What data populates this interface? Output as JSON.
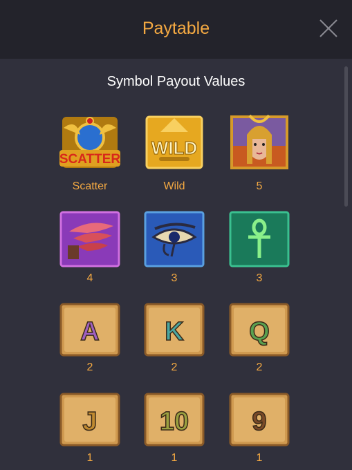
{
  "header": {
    "title": "Paytable"
  },
  "subtitle": "Symbol Payout Values",
  "symbols": [
    {
      "name": "scatter",
      "label": "Scatter",
      "art": "SCATTER",
      "kind": "scatter"
    },
    {
      "name": "wild",
      "label": "Wild",
      "art": "WILD",
      "kind": "wild"
    },
    {
      "name": "cleopatra",
      "label": "5",
      "art": "",
      "kind": "queen"
    },
    {
      "name": "wings",
      "label": "4",
      "art": "",
      "kind": "wings"
    },
    {
      "name": "eye-of-horus",
      "label": "3",
      "art": "",
      "kind": "eye"
    },
    {
      "name": "ankh",
      "label": "3",
      "art": "",
      "kind": "ankh"
    },
    {
      "name": "letter-a",
      "label": "2",
      "art": "A",
      "kind": "card",
      "color": "#a060c0"
    },
    {
      "name": "letter-k",
      "label": "2",
      "art": "K",
      "kind": "card",
      "color": "#4aa6a0"
    },
    {
      "name": "letter-q",
      "label": "2",
      "art": "Q",
      "kind": "card",
      "color": "#5aa050"
    },
    {
      "name": "letter-j",
      "label": "1",
      "art": "J",
      "kind": "card",
      "color": "#c08a30"
    },
    {
      "name": "number-10",
      "label": "1",
      "art": "10",
      "kind": "card",
      "color": "#9aa040"
    },
    {
      "name": "number-9",
      "label": "1",
      "art": "9",
      "kind": "card",
      "color": "#7a4a28"
    }
  ],
  "colors": {
    "accent": "#f4a942",
    "header_bg": "#23232b",
    "page_bg": "#30303c"
  }
}
